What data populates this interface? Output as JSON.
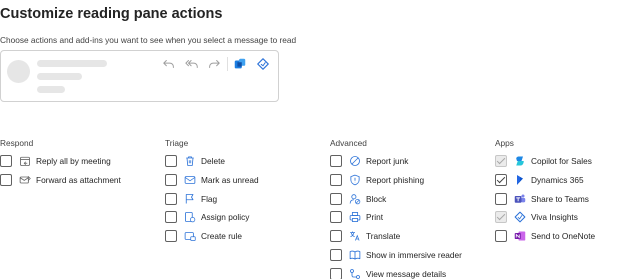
{
  "page": {
    "title": "Customize reading pane actions",
    "subtitle": "Choose actions and add-ins you want to see when you select a message to read"
  },
  "preview": {
    "icons": [
      "undo-icon",
      "reply-all-icon",
      "forward-icon",
      "teams-app-icon",
      "viva-insights-icon"
    ]
  },
  "colors": {
    "icon_stroke": "#616161",
    "checkbox_border": "#616161",
    "disabled_checkbox": "#ebebeb",
    "placeholder": "#e6e6e6"
  },
  "columns": [
    {
      "heading": "Respond",
      "items": [
        {
          "label": "Reply all by meeting",
          "icon": "calendar-reply-icon",
          "checked": false,
          "disabled": false
        },
        {
          "label": "Forward as attachment",
          "icon": "mail-attachment-icon",
          "checked": false,
          "disabled": false
        }
      ]
    },
    {
      "heading": "Triage",
      "items": [
        {
          "label": "Delete",
          "icon": "trash-icon",
          "checked": false,
          "disabled": false
        },
        {
          "label": "Mark as unread",
          "icon": "envelope-icon",
          "checked": false,
          "disabled": false
        },
        {
          "label": "Flag",
          "icon": "flag-icon",
          "checked": false,
          "disabled": false
        },
        {
          "label": "Assign policy",
          "icon": "policy-icon",
          "checked": false,
          "disabled": false
        },
        {
          "label": "Create rule",
          "icon": "rule-icon",
          "checked": false,
          "disabled": false
        }
      ]
    },
    {
      "heading": "Advanced",
      "items": [
        {
          "label": "Report junk",
          "icon": "block-circle-icon",
          "checked": false,
          "disabled": false
        },
        {
          "label": "Report phishing",
          "icon": "shield-icon",
          "checked": false,
          "disabled": false
        },
        {
          "label": "Block",
          "icon": "block-person-icon",
          "checked": false,
          "disabled": false
        },
        {
          "label": "Print",
          "icon": "printer-icon",
          "checked": false,
          "disabled": false
        },
        {
          "label": "Translate",
          "icon": "translate-icon",
          "checked": false,
          "disabled": false
        },
        {
          "label": "Show in immersive reader",
          "icon": "immersive-reader-icon",
          "checked": false,
          "disabled": false
        },
        {
          "label": "View message details",
          "icon": "message-details-icon",
          "checked": false,
          "disabled": false
        }
      ]
    },
    {
      "heading": "Apps",
      "items": [
        {
          "label": "Copilot for Sales",
          "icon": "copilot-sales-icon",
          "checked": true,
          "disabled": true
        },
        {
          "label": "Dynamics 365",
          "icon": "dynamics-icon",
          "checked": true,
          "disabled": false
        },
        {
          "label": "Share to Teams",
          "icon": "teams-icon",
          "checked": false,
          "disabled": false
        },
        {
          "label": "Viva Insights",
          "icon": "viva-insights-icon",
          "checked": true,
          "disabled": true
        },
        {
          "label": "Send to OneNote",
          "icon": "onenote-icon",
          "checked": false,
          "disabled": false
        }
      ]
    }
  ]
}
